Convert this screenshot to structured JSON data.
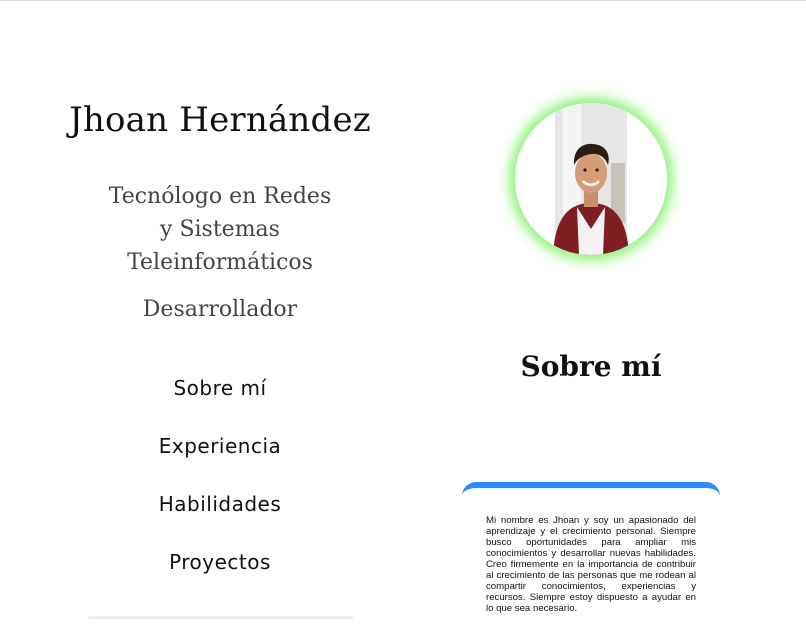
{
  "profile": {
    "name": "Jhoan Hernández",
    "subtitle": "Tecnólogo en Redes y Sistemas Teleinformáticos",
    "subtitle_lines": [
      "Tecnólogo en Redes",
      "y Sistemas",
      "Teleinformáticos"
    ],
    "role": "Desarrollador"
  },
  "nav": {
    "items": [
      {
        "label": "Sobre mí"
      },
      {
        "label": "Experiencia"
      },
      {
        "label": "Habilidades"
      },
      {
        "label": "Proyectos"
      }
    ]
  },
  "about": {
    "title": "Sobre mí",
    "text": "Mi nombre es Jhoan y soy un apasionado del aprendizaje y el crecimiento personal. Siempre busco oportunidades para ampliar mis conocimientos y desarrollar nuevas habilidades. Creo firmemente en la importancia de contribuir al crecimiento de las personas que me rodean al compartir conocimientos, experiencias y recursos. Siempre estoy dispuesto a ayudar en lo que sea necesario."
  },
  "colors": {
    "avatar_glow": "#8ff27a",
    "card_accent": "#2d8cff",
    "text_dark": "#111111",
    "text_muted": "#444444"
  },
  "icons": {
    "avatar": "profile-photo"
  }
}
